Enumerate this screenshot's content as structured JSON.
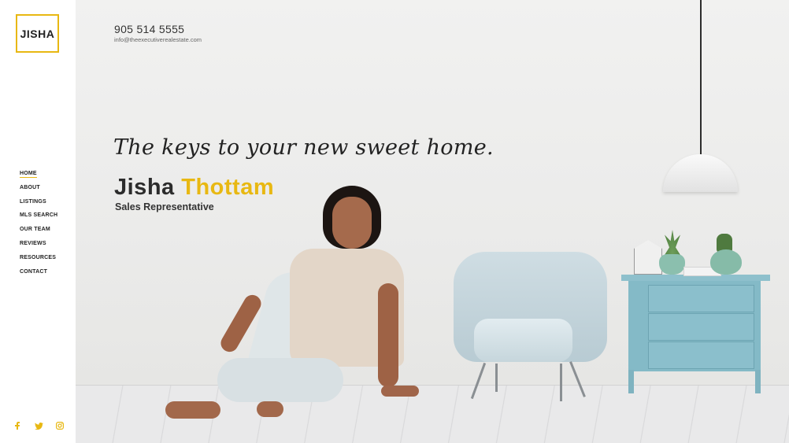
{
  "brand": {
    "logo_text": "JISHA",
    "accent_color": "#e8b812"
  },
  "contact": {
    "phone": "905 514 5555",
    "email": "info@theexecutiverealestate.com"
  },
  "nav": {
    "items": [
      {
        "label": "HOME",
        "active": true
      },
      {
        "label": "ABOUT"
      },
      {
        "label": "LISTINGS"
      },
      {
        "label": "MLS SEARCH"
      },
      {
        "label": "OUR TEAM"
      },
      {
        "label": "REVIEWS"
      },
      {
        "label": "RESOURCES"
      },
      {
        "label": "CONTACT"
      }
    ]
  },
  "hero": {
    "tagline": "The keys to your new sweet home.",
    "first_name": "Jisha",
    "last_name": "Thottam",
    "role": "Sales Representative"
  },
  "social": [
    {
      "icon": "facebook-icon",
      "glyph": "f"
    },
    {
      "icon": "twitter-icon",
      "glyph": "t"
    },
    {
      "icon": "instagram-icon",
      "glyph": "ig"
    }
  ]
}
